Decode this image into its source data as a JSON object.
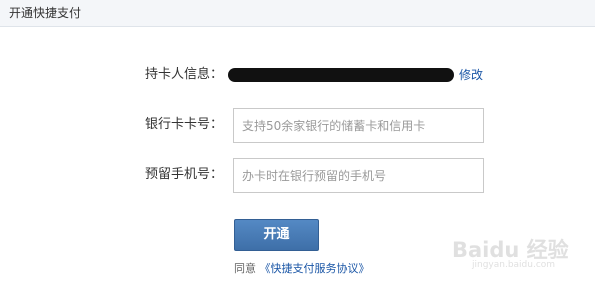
{
  "header": {
    "title": "开通快捷支付"
  },
  "form": {
    "cardholder_label": "持卡人信息：",
    "modify_link": "修改",
    "card_number_label": "银行卡卡号：",
    "card_number_placeholder": "支持50余家银行的储蓄卡和信用卡",
    "phone_label": "预留手机号：",
    "phone_placeholder": "办卡时在银行预留的手机号"
  },
  "actions": {
    "open_button": "开通"
  },
  "agreement": {
    "prefix": "同意",
    "link": "《快捷支付服务协议》"
  },
  "watermark": {
    "text": "Baidu 经验",
    "url": "jingyan.baidu.com"
  }
}
